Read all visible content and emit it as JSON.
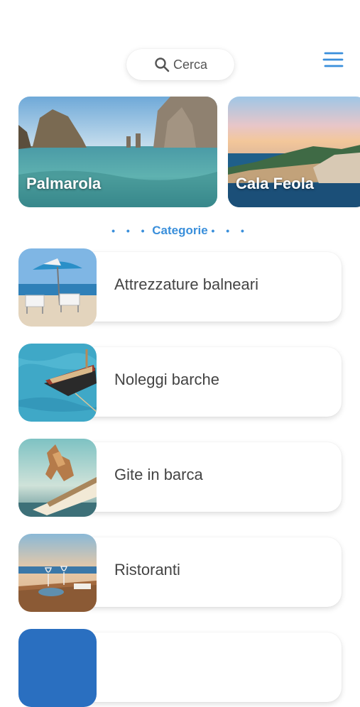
{
  "header": {
    "search_label": "Cerca",
    "search_icon": "search-icon",
    "menu_icon": "hamburger-menu-icon"
  },
  "destinations": [
    {
      "name": "Palmarola"
    },
    {
      "name": "Cala Feola"
    }
  ],
  "categories_heading": {
    "dots": "• • •",
    "label": "Categorie"
  },
  "categories": [
    {
      "label": "Attrezzature balneari"
    },
    {
      "label": "Noleggi barche"
    },
    {
      "label": "Gite in barca"
    },
    {
      "label": "Ristoranti"
    },
    {
      "label": ""
    }
  ],
  "colors": {
    "accent": "#3a8fdb",
    "text": "#444444"
  }
}
